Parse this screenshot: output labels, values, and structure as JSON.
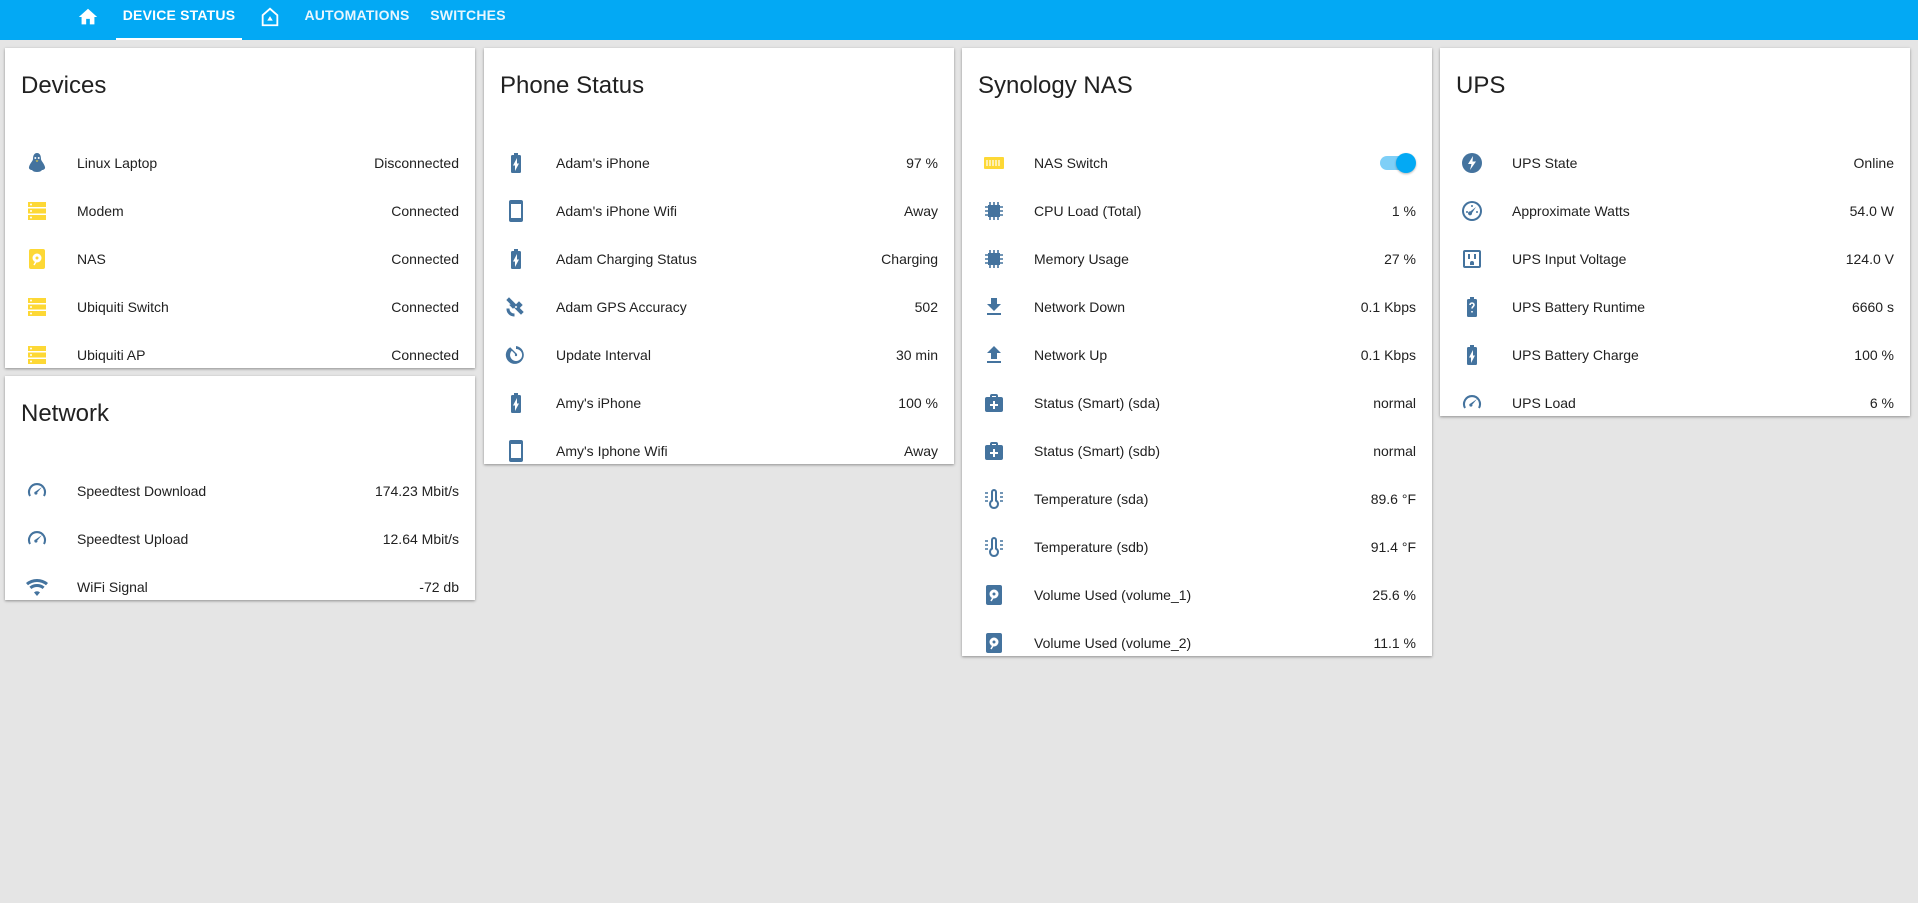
{
  "colors": {
    "header": "#03a9f4",
    "icon_blue": "#44739e",
    "icon_yellow": "#fdd835",
    "background": "#e5e5e5"
  },
  "tabs": [
    {
      "icon": "home-icon"
    },
    {
      "label": "DEVICE STATUS",
      "active": true
    },
    {
      "icon": "home-automation-icon"
    },
    {
      "label": "AUTOMATIONS"
    },
    {
      "label": "SWITCHES"
    }
  ],
  "cards": {
    "devices": {
      "title": "Devices",
      "rows": [
        {
          "label": "Linux Laptop",
          "value": "Disconnected",
          "icon": "linux-icon"
        },
        {
          "label": "Modem",
          "value": "Connected",
          "icon": "server-icon"
        },
        {
          "label": "NAS",
          "value": "Connected",
          "icon": "harddisk-icon"
        },
        {
          "label": "Ubiquiti Switch",
          "value": "Connected",
          "icon": "server-icon"
        },
        {
          "label": "Ubiquiti AP",
          "value": "Connected",
          "icon": "server-icon"
        }
      ]
    },
    "network": {
      "title": "Network",
      "rows": [
        {
          "label": "Speedtest Download",
          "value": "174.23 Mbit/s",
          "icon": "speedometer-icon"
        },
        {
          "label": "Speedtest Upload",
          "value": "12.64 Mbit/s",
          "icon": "speedometer-icon"
        },
        {
          "label": "WiFi Signal",
          "value": "-72 db",
          "icon": "wifi-icon"
        }
      ]
    },
    "phone": {
      "title": "Phone Status",
      "rows": [
        {
          "label": "Adam's iPhone",
          "value": "97 %",
          "icon": "battery-charging-icon"
        },
        {
          "label": "Adam's iPhone Wifi",
          "value": "Away",
          "icon": "cellphone-icon"
        },
        {
          "label": "Adam Charging Status",
          "value": "Charging",
          "icon": "battery-charging-icon"
        },
        {
          "label": "Adam GPS Accuracy",
          "value": "502",
          "icon": "satellite-icon"
        },
        {
          "label": "Update Interval",
          "value": "30 min",
          "icon": "timer-icon"
        },
        {
          "label": "Amy's iPhone",
          "value": "100 %",
          "icon": "battery-charging-icon"
        },
        {
          "label": "Amy's Iphone Wifi",
          "value": "Away",
          "icon": "cellphone-icon"
        }
      ]
    },
    "nas": {
      "title": "Synology NAS",
      "switch": {
        "label": "NAS Switch",
        "icon": "nas-icon",
        "on": true
      },
      "rows": [
        {
          "label": "CPU Load (Total)",
          "value": "1 %",
          "icon": "chip-icon"
        },
        {
          "label": "Memory Usage",
          "value": "27 %",
          "icon": "memory-icon"
        },
        {
          "label": "Network Down",
          "value": "0.1 Kbps",
          "icon": "download-icon"
        },
        {
          "label": "Network Up",
          "value": "0.1 Kbps",
          "icon": "upload-icon"
        },
        {
          "label": "Status (Smart) (sda)",
          "value": "normal",
          "icon": "medical-bag-icon"
        },
        {
          "label": "Status (Smart) (sdb)",
          "value": "normal",
          "icon": "medical-bag-icon"
        },
        {
          "label": "Temperature (sda)",
          "value": "89.6 °F",
          "icon": "thermometer-icon"
        },
        {
          "label": "Temperature (sdb)",
          "value": "91.4 °F",
          "icon": "thermometer-icon"
        },
        {
          "label": "Volume Used (volume_1)",
          "value": "25.6 %",
          "icon": "harddisk-icon"
        },
        {
          "label": "Volume Used (volume_2)",
          "value": "11.1 %",
          "icon": "harddisk-icon"
        }
      ]
    },
    "ups": {
      "title": "UPS",
      "rows": [
        {
          "label": "UPS State",
          "value": "Online",
          "icon": "flash-circle-icon"
        },
        {
          "label": "Approximate Watts",
          "value": "54.0 W",
          "icon": "gauge-icon"
        },
        {
          "label": "UPS Input Voltage",
          "value": "124.0 V",
          "icon": "power-socket-icon"
        },
        {
          "label": "UPS Battery Runtime",
          "value": "6660 s",
          "icon": "battery-unknown-icon"
        },
        {
          "label": "UPS Battery Charge",
          "value": "100 %",
          "icon": "battery-charging-icon"
        },
        {
          "label": "UPS Load",
          "value": "6 %",
          "icon": "speedometer-icon"
        }
      ]
    }
  }
}
